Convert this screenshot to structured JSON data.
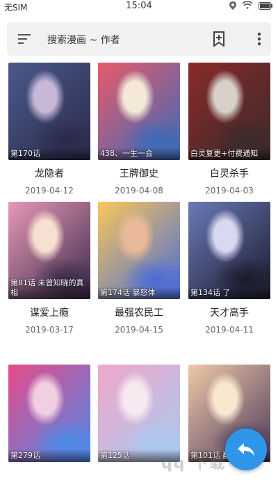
{
  "status_bar": {
    "carrier": "无SIM",
    "time": "15:04",
    "icons": [
      "location-icon",
      "wifi-icon",
      "battery-icon"
    ]
  },
  "search": {
    "placeholder": "搜索漫画 ~ 作者",
    "icons": [
      "menu-icon",
      "bookmark-add-icon",
      "more-vert-icon"
    ]
  },
  "comics": [
    {
      "title": "龙隐者",
      "date": "2019-04-12",
      "chapter": "第170话",
      "colors": [
        "#4a5a8a",
        "#c8b8d8",
        "#2a2a4a"
      ]
    },
    {
      "title": "王牌御史",
      "date": "2019-04-08",
      "chapter": "438、一生一会",
      "colors": [
        "#e85a6a",
        "#f4e8d8",
        "#3a6ab8"
      ]
    },
    {
      "title": "白灵杀手",
      "date": "2019-04-03",
      "chapter": "白灵复更+付费通知",
      "colors": [
        "#8a2a2a",
        "#d8d0c8",
        "#3a2a2a"
      ]
    },
    {
      "title": "谋爱上瘾",
      "date": "2019-03-17",
      "chapter": "第81话 未曾知晓的真相",
      "colors": [
        "#e898b8",
        "#f8e0d0",
        "#3a2a4a"
      ]
    },
    {
      "title": "最强农民工",
      "date": "2019-04-15",
      "chapter": "第174话 暴怒体",
      "colors": [
        "#f8c858",
        "#e8b898",
        "#4a6ad8"
      ]
    },
    {
      "title": "天才高手",
      "date": "2019-04-11",
      "chapter": "第134话 了",
      "colors": [
        "#6a7ab8",
        "#d8d8f0",
        "#1a1a2a"
      ]
    },
    {
      "title": "",
      "date": "",
      "chapter": "第279话",
      "colors": [
        "#e84a8a",
        "#f0d0e0",
        "#4a8ae8"
      ]
    },
    {
      "title": "",
      "date": "",
      "chapter": "第125话",
      "colors": [
        "#f0a8c8",
        "#f8e8f0",
        "#a8c8f0"
      ]
    },
    {
      "title": "",
      "date": "",
      "chapter": "第101话 翻脸之位",
      "colors": [
        "#f0c8a8",
        "#f8e8d0",
        "#4a3a5a"
      ]
    }
  ],
  "fab": {
    "icon": "reply-icon",
    "color": "#2f95e8"
  }
}
